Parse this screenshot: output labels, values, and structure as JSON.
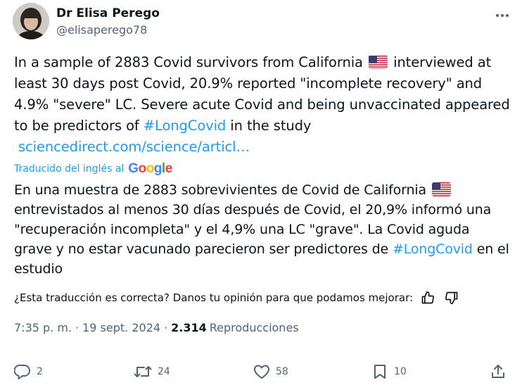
{
  "author": {
    "display_name": "Dr Elisa Perego",
    "handle": "@elisaperego78"
  },
  "tweet": {
    "text_part1": "In a sample of 2883 Covid survivors from California",
    "text_part2": " interviewed at least 30 days post Covid, 20.9% reported \"incomplete recovery\" and 4.9% \"severe\" LC. Severe acute Covid and being unvaccinated appeared to be predictors of ",
    "hashtag": "#LongCovid",
    "text_part3": " in the study",
    "link": "sciencedirect.com/science/articl…"
  },
  "translation": {
    "label": "Traducido del inglés al",
    "provider": {
      "g1": "G",
      "g2": "o",
      "g3": "o",
      "g4": "g",
      "g5": "l",
      "g6": "e"
    },
    "text_part1": "En una muestra de 2883 sobrevivientes de Covid de California",
    "text_part2": " entrevistados al menos 30 días después de Covid, el 20,9% informó una \"recuperación incompleta\" y el 4,9% una LC \"grave\". La Covid aguda grave y no estar vacunado parecieron ser predictores de ",
    "hashtag": "#LongCovid",
    "text_part3": " en el estudio"
  },
  "feedback": {
    "prompt": "¿Esta traducción es correcta? Danos tu opinión para que podamos mejorar:"
  },
  "meta": {
    "time": "7:35 p. m.",
    "dot1": "·",
    "date": "19 sept. 2024",
    "dot2": "·",
    "views_count": "2.314",
    "views_label": "Reproducciones"
  },
  "actions": {
    "replies": "2",
    "retweets": "24",
    "likes": "58",
    "bookmarks": "10"
  },
  "colors": {
    "link": "#1d9bf0",
    "muted": "#536471",
    "text": "#0f1419"
  }
}
